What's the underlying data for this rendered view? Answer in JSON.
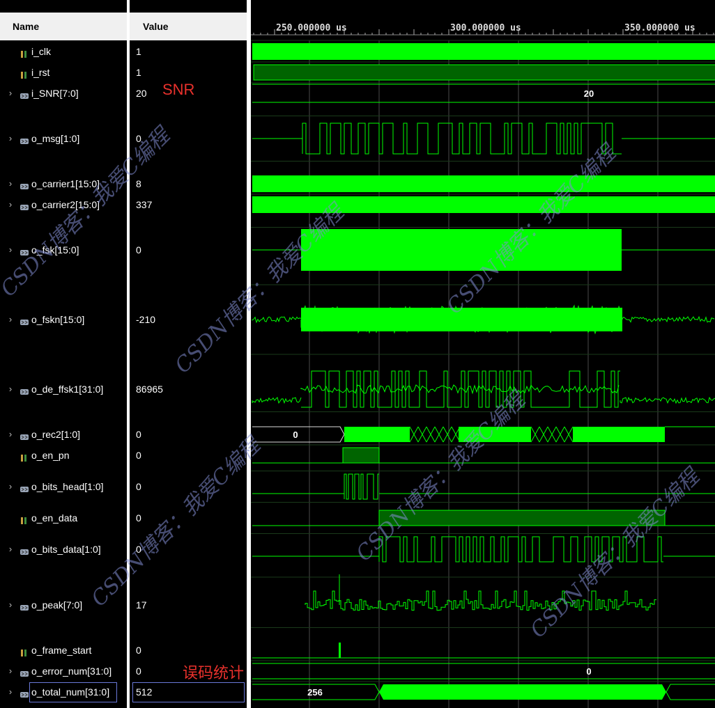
{
  "header": {
    "name": "Name",
    "value": "Value"
  },
  "time_ruler": [
    "250.000000 us",
    "300.000000 us",
    "350.000000 us"
  ],
  "signals": [
    {
      "name": "i_clk",
      "value": "1",
      "expandable": false
    },
    {
      "name": "i_rst",
      "value": "1",
      "expandable": false
    },
    {
      "name": "i_SNR[7:0]",
      "value": "20",
      "expandable": true
    },
    {
      "name": "o_msg[1:0]",
      "value": "0",
      "expandable": true
    },
    {
      "name": "o_carrier1[15:0]",
      "value": "8",
      "expandable": true
    },
    {
      "name": "o_carrier2[15:0]",
      "value": "337",
      "expandable": true
    },
    {
      "name": "o_fsk[15:0]",
      "value": "0",
      "expandable": true
    },
    {
      "name": "o_fskn[15:0]",
      "value": "-210",
      "expandable": true
    },
    {
      "name": "o_de_ffsk1[31:0]",
      "value": "86965",
      "expandable": true
    },
    {
      "name": "o_rec2[1:0]",
      "value": "0",
      "expandable": true
    },
    {
      "name": "o_en_pn",
      "value": "0",
      "expandable": false
    },
    {
      "name": "o_bits_head[1:0]",
      "value": "0",
      "expandable": true
    },
    {
      "name": "o_en_data",
      "value": "0",
      "expandable": false
    },
    {
      "name": "o_bits_data[1:0]",
      "value": "0",
      "expandable": true
    },
    {
      "name": "o_peak[7:0]",
      "value": "17",
      "expandable": true
    },
    {
      "name": "o_frame_start",
      "value": "0",
      "expandable": false
    },
    {
      "name": "o_error_num[31:0]",
      "value": "0",
      "expandable": true
    },
    {
      "name": "o_total_num[31:0]",
      "value": "512",
      "expandable": true
    }
  ],
  "wave_labels": {
    "snr": "20",
    "rec2": "0",
    "error_num": "0",
    "total_num": "256"
  },
  "annotations": {
    "snr": "SNR",
    "error": "误码统计"
  },
  "watermark": "CSDN博客：我爱C编程",
  "colors": {
    "wave": "#00ff00",
    "wave_dark": "#006400",
    "grid": "#4a4a4a",
    "annotation": "#e8312c"
  }
}
